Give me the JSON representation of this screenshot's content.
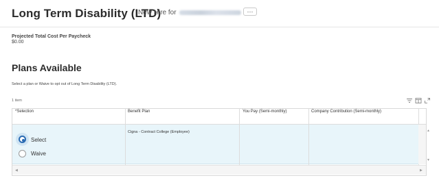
{
  "header": {
    "title": "Long Term Disability (LTD)",
    "subtitle_prefix": "New Hire for",
    "more_label": "⋯"
  },
  "summary": {
    "cost_label": "Projected Total Cost Per Paycheck",
    "cost_value": "$0.00"
  },
  "plans": {
    "heading": "Plans Available",
    "instructions": "Select a plan or Waive to opt out of Long Term Disability (LTD).",
    "item_count": "1 item"
  },
  "table": {
    "columns": [
      "*Selection",
      "Benefit Plan",
      "You Pay (Semi-monthly)",
      "Company Contribution (Semi-monthly)"
    ],
    "rows": [
      {
        "options": [
          "Select",
          "Waive"
        ],
        "selected": "Select",
        "benefit_plan": "Cigna - Contract College (Employee)",
        "you_pay": "",
        "company_contribution": ""
      }
    ]
  },
  "icons": {
    "filter": "filter-icon",
    "columns": "columns-icon",
    "expand": "expand-icon"
  },
  "colors": {
    "accent": "#2a6bb3",
    "row_highlight": "#e8f5fa"
  }
}
